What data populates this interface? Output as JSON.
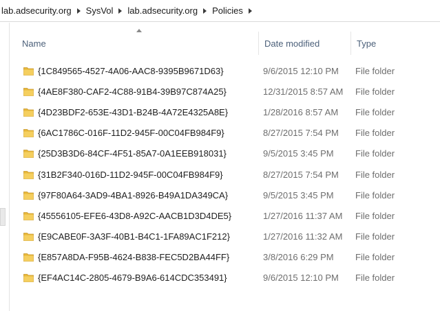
{
  "breadcrumb": {
    "items": [
      "lab.adsecurity.org",
      "SysVol",
      "lab.adsecurity.org",
      "Policies"
    ]
  },
  "columns": {
    "name": "Name",
    "date_modified": "Date modified",
    "type": "Type"
  },
  "files": [
    {
      "name": "{1C849565-4527-4A06-AAC8-9395B9671D63}",
      "date": "9/6/2015 12:10 PM",
      "type": "File folder"
    },
    {
      "name": "{4AE8F380-CAF2-4C88-91B4-39B97C874A25}",
      "date": "12/31/2015 8:57 AM",
      "type": "File folder"
    },
    {
      "name": "{4D23BDF2-653E-43D1-B24B-4A72E4325A8E}",
      "date": "1/28/2016 8:57 AM",
      "type": "File folder"
    },
    {
      "name": "{6AC1786C-016F-11D2-945F-00C04FB984F9}",
      "date": "8/27/2015 7:54 PM",
      "type": "File folder"
    },
    {
      "name": "{25D3B3D6-84CF-4F51-85A7-0A1EEB918031}",
      "date": "9/5/2015 3:45 PM",
      "type": "File folder"
    },
    {
      "name": "{31B2F340-016D-11D2-945F-00C04FB984F9}",
      "date": "8/27/2015 7:54 PM",
      "type": "File folder"
    },
    {
      "name": "{97F80A64-3AD9-4BA1-8926-B49A1DA349CA}",
      "date": "9/5/2015 3:45 PM",
      "type": "File folder"
    },
    {
      "name": "{45556105-EFE6-43D8-A92C-AACB1D3D4DE5}",
      "date": "1/27/2016 11:37 AM",
      "type": "File folder"
    },
    {
      "name": "{E9CABE0F-3A3F-40B1-B4C1-1FA89AC1F212}",
      "date": "1/27/2016 11:32 AM",
      "type": "File folder"
    },
    {
      "name": "{E857A8DA-F95B-4624-B838-FEC5D2BA44FF}",
      "date": "3/8/2016 6:29 PM",
      "type": "File folder"
    },
    {
      "name": "{EF4AC14C-2805-4679-B9A6-614CDC353491}",
      "date": "9/6/2015 12:10 PM",
      "type": "File folder"
    }
  ],
  "icons": {
    "separator": "chevron-right-icon",
    "folder": "folder-icon",
    "sort": "sort-ascending-icon"
  },
  "colors": {
    "header_text": "#4c607a",
    "folder": "#e8b83a",
    "secondary_text": "#6d6d6d"
  }
}
